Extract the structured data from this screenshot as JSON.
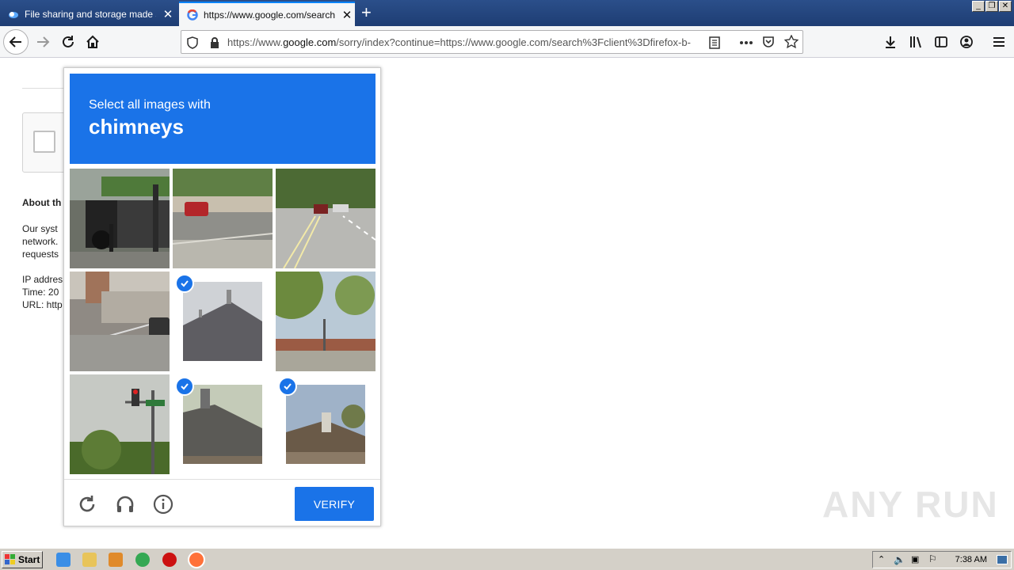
{
  "browser": {
    "tabs": [
      {
        "title": "File sharing and storage made sim"
      },
      {
        "title": "https://www.google.com/search?cl"
      }
    ],
    "url_prefix": "https://www.",
    "url_domain": "google.com",
    "url_rest": "/sorry/index?continue=https://www.google.com/search%3Fclient%3Dfirefox-b-"
  },
  "page": {
    "about_heading": "About th",
    "para1": [
      "Our syst",
      "network.",
      "requests"
    ],
    "para2": [
      "IP addres",
      "Time: 20",
      "URL: http"
    ]
  },
  "captcha": {
    "instruction": "Select all images with",
    "target": "chimneys",
    "verify_label": "VERIFY",
    "tiles": [
      {
        "content": "motorcycle-street",
        "selected": false
      },
      {
        "content": "red-car-road",
        "selected": false
      },
      {
        "content": "highway-cars",
        "selected": false
      },
      {
        "content": "overpass-road",
        "selected": false
      },
      {
        "content": "roof-vent",
        "selected": true
      },
      {
        "content": "trees-buildings",
        "selected": false
      },
      {
        "content": "traffic-light",
        "selected": false
      },
      {
        "content": "roof-chimney",
        "selected": true
      },
      {
        "content": "house-chimney",
        "selected": true
      }
    ]
  },
  "watermark": "ANY RUN",
  "taskbar": {
    "start_label": "Start",
    "clock": "7:38 AM"
  }
}
